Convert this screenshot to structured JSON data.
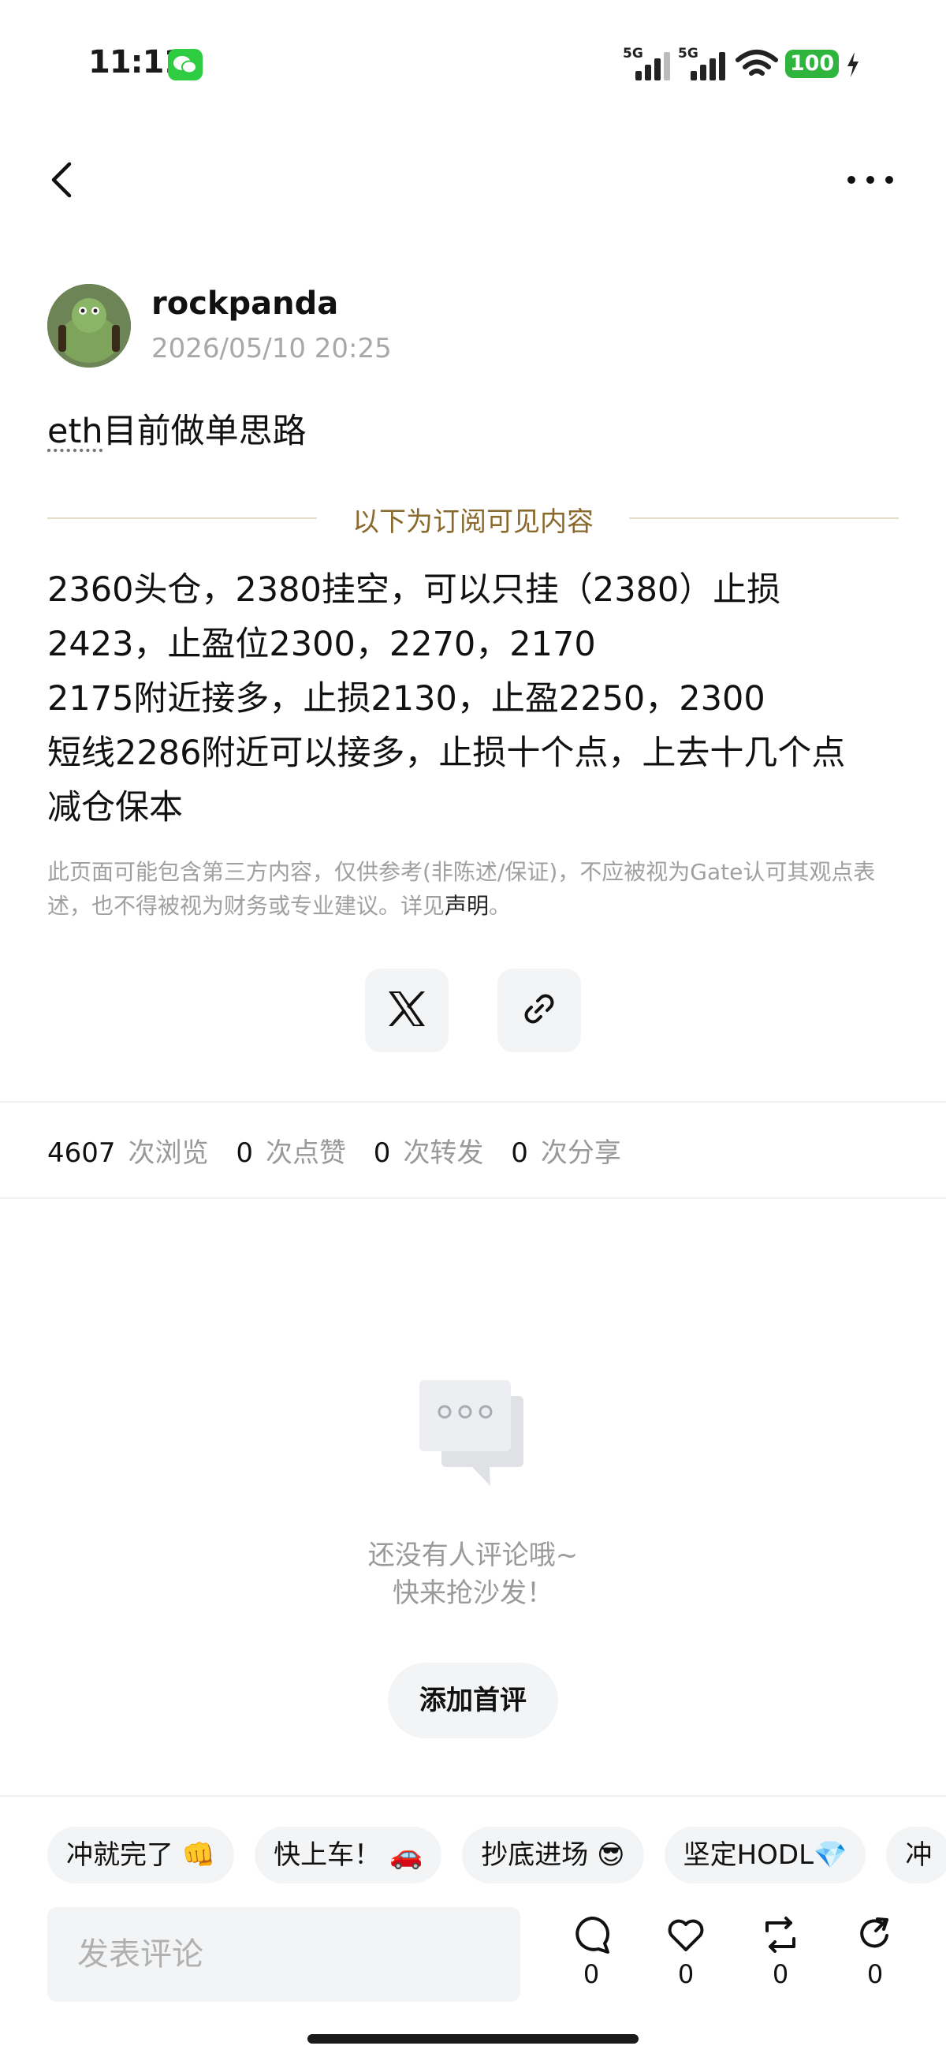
{
  "status_bar": {
    "time": "11:11",
    "network_1": "5G",
    "network_2": "5G",
    "battery": "100"
  },
  "post": {
    "author": "rockpanda",
    "timestamp": "2026/05/10 20:25",
    "title_prefix": "eth",
    "title_rest": "目前做单思路",
    "subscriber_divider": "以下为订阅可见内容",
    "content_lines": [
      "2360头仓，2380挂空，可以只挂（2380）止损",
      "2423，止盈位2300，2270，2170",
      "2175附近接多，止损2130，止盈2250，2300",
      "短线2286附近可以接多，止损十个点，上去十几个点",
      "减仓保本"
    ],
    "disclaimer": "此页面可能包含第三方内容，仅供参考(非陈述/保证)，不应被视为Gate认可其观点表述，也不得被视为财务或专业建议。详见",
    "disclaimer_link": "声明",
    "disclaimer_end": "。"
  },
  "stats": {
    "views": "4607",
    "views_label": "次浏览",
    "likes": "0",
    "likes_label": "次点赞",
    "reposts": "0",
    "reposts_label": "次转发",
    "shares": "0",
    "shares_label": "次分享"
  },
  "empty_state": {
    "line1": "还没有人评论哦~",
    "line2": "快来抢沙发！",
    "button": "添加首评"
  },
  "quick_replies": [
    "冲就完了 👊",
    "快上车！ 🚗",
    "抄底进场 😎",
    "坚定HODL💎",
    "冲"
  ],
  "bottom_bar": {
    "comment_placeholder": "发表评论",
    "comment_count": "0",
    "like_count": "0",
    "repost_count": "0",
    "share_count": "0"
  },
  "colors": {
    "accent_gold": "#8a6a2c",
    "battery_green": "#2fb53e",
    "chip_bg": "#f3f4f5"
  }
}
